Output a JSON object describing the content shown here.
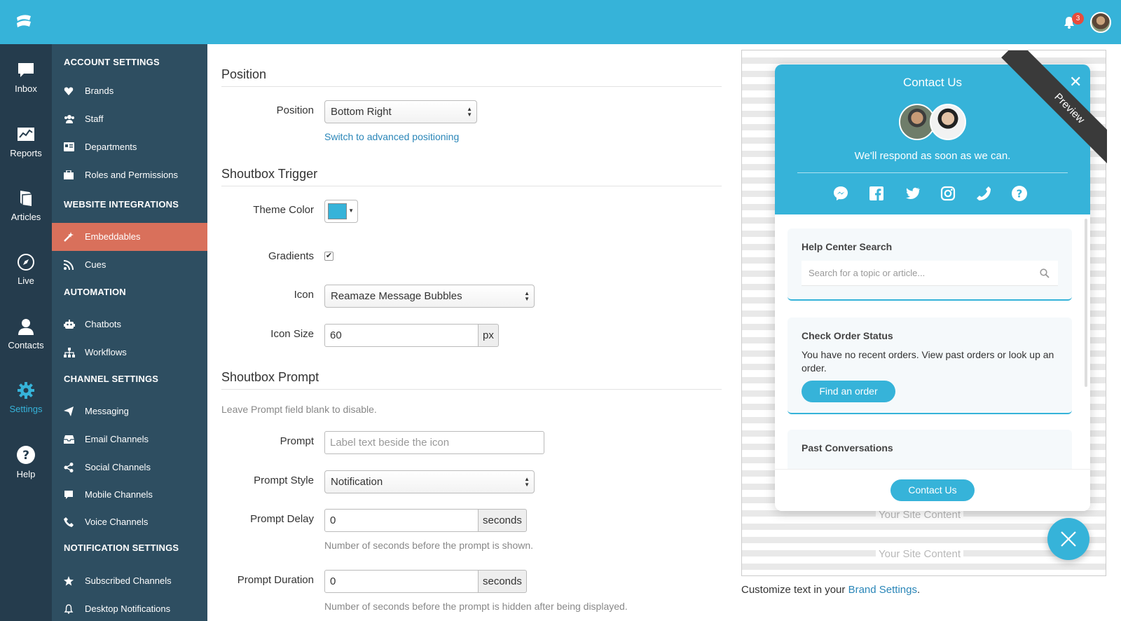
{
  "topbar": {
    "notification_count": "3"
  },
  "rail": [
    {
      "label": "Inbox",
      "icon": "chat-bubble-icon"
    },
    {
      "label": "Reports",
      "icon": "chart-icon"
    },
    {
      "label": "Articles",
      "icon": "book-icon"
    },
    {
      "label": "Live",
      "icon": "compass-icon"
    },
    {
      "label": "Contacts",
      "icon": "person-icon"
    },
    {
      "label": "Settings",
      "icon": "gear-icon"
    },
    {
      "label": "Help",
      "icon": "question-icon"
    }
  ],
  "sidebar": {
    "account_header": "ACCOUNT SETTINGS",
    "brands": "Brands",
    "staff": "Staff",
    "departments": "Departments",
    "roles": "Roles and Permissions",
    "website_header": "WEBSITE INTEGRATIONS",
    "embeddables": "Embeddables",
    "cues": "Cues",
    "automation_header": "AUTOMATION",
    "chatbots": "Chatbots",
    "workflows": "Workflows",
    "channel_header": "CHANNEL SETTINGS",
    "messaging": "Messaging",
    "email": "Email Channels",
    "social": "Social Channels",
    "mobile": "Mobile Channels",
    "voice": "Voice Channels",
    "notification_header": "NOTIFICATION SETTINGS",
    "subscribed": "Subscribed Channels",
    "desktop": "Desktop Notifications"
  },
  "form": {
    "position_title": "Position",
    "position_label": "Position",
    "position_value": "Bottom Right",
    "advanced_link": "Switch to advanced positioning",
    "trigger_title": "Shoutbox Trigger",
    "theme_color_label": "Theme Color",
    "theme_color": "#36b3d9",
    "gradients_label": "Gradients",
    "gradients_checked": true,
    "icon_label": "Icon",
    "icon_value": "Reamaze Message Bubbles",
    "icon_size_label": "Icon Size",
    "icon_size_value": "60",
    "icon_size_unit": "px",
    "prompt_title": "Shoutbox Prompt",
    "prompt_hint": "Leave Prompt field blank to disable.",
    "prompt_label": "Prompt",
    "prompt_placeholder": "Label text beside the icon",
    "prompt_style_label": "Prompt Style",
    "prompt_style_value": "Notification",
    "prompt_delay_label": "Prompt Delay",
    "prompt_delay_value": "0",
    "prompt_delay_unit": "seconds",
    "prompt_delay_help": "Number of seconds before the prompt is shown.",
    "prompt_duration_label": "Prompt Duration",
    "prompt_duration_value": "0",
    "prompt_duration_unit": "seconds",
    "prompt_duration_help": "Number of seconds before the prompt is hidden after being displayed."
  },
  "preview": {
    "ribbon": "Preview",
    "title": "Contact Us",
    "subtitle": "We'll respond as soon as we can.",
    "help_center_title": "Help Center Search",
    "search_placeholder": "Search for a topic or article...",
    "order_title": "Check Order Status",
    "order_text": "You have no recent orders. View past orders or look up an order.",
    "find_order_button": "Find an order",
    "past_title": "Past Conversations",
    "contact_button": "Contact Us",
    "site_content_1": "Your Site Content",
    "site_content_2": "Your Site Content"
  },
  "caption": {
    "prefix": "Customize text in your ",
    "link": "Brand Settings",
    "suffix": "."
  }
}
